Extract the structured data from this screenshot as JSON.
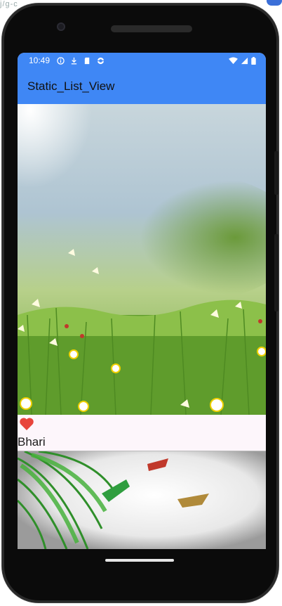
{
  "status_bar": {
    "time": "10:49",
    "left_icons": [
      "info-icon",
      "download-icon",
      "sd-card-icon",
      "sync-icon"
    ],
    "right_icons": [
      "wifi-icon",
      "signal-icon",
      "battery-icon"
    ],
    "color": "#3f87f5"
  },
  "app_bar": {
    "title": "Static_List_View",
    "color": "#3f87f5"
  },
  "list": {
    "items": [
      {
        "label": "Bhari",
        "image": "meadow-butterflies-image",
        "icon": "heart-icon",
        "icon_color": "#e8453c"
      },
      {
        "label": "",
        "image": "parrots-palm-image"
      }
    ]
  },
  "bezel": {
    "edge_text": "j/g-c"
  }
}
